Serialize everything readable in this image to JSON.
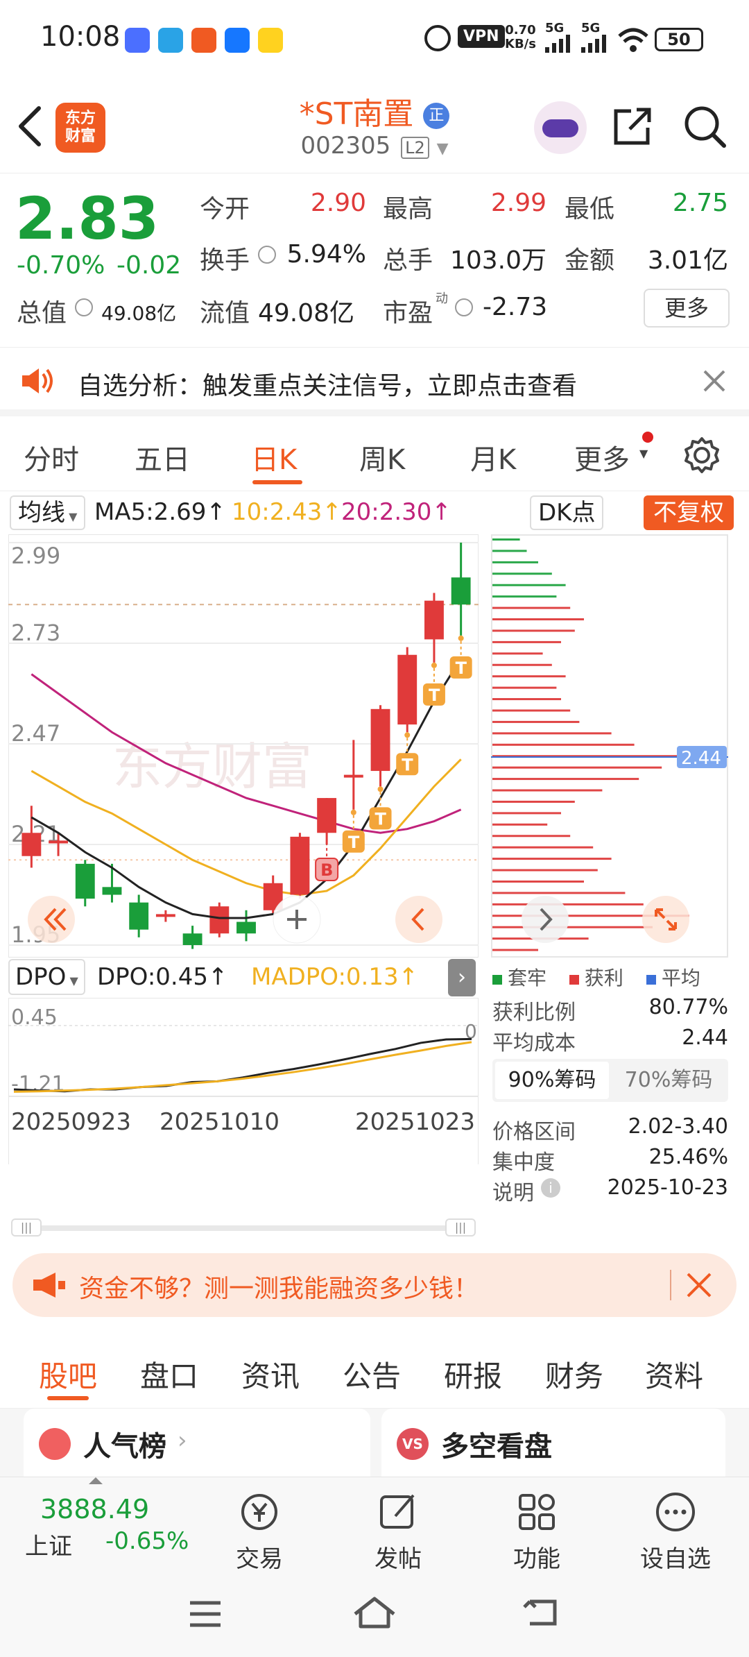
{
  "status_bar": {
    "time": "10:08",
    "network_speed_value": "0.70",
    "network_speed_unit": "KB/s",
    "vpn": "VPN",
    "signal1": "5G",
    "signal2": "5G",
    "battery": "50"
  },
  "header": {
    "logo_line1": "东方",
    "logo_line2": "财富",
    "stock_name": "*ST南置",
    "stock_code": "002305",
    "level_badge": "L2",
    "verified_badge": "正"
  },
  "quote": {
    "price": "2.83",
    "change_pct": "-0.70%",
    "change": "-0.02",
    "fields": {
      "open_label": "今开",
      "open": "2.90",
      "high_label": "最高",
      "high": "2.99",
      "low_label": "最低",
      "low": "2.75",
      "turnover_label": "换手",
      "turnover": "5.94%",
      "volume_label": "总手",
      "volume": "103.0万",
      "amount_label": "金额",
      "amount": "3.01亿",
      "mktcap_label": "总值",
      "mktcap": "49.08亿",
      "float_label": "流值",
      "float": "49.08亿",
      "pe_label": "市盈",
      "pe_super": "动",
      "pe": "-2.73"
    },
    "more_button": "更多"
  },
  "notice": {
    "text": "自选分析：触发重点关注信号，立即点击查看"
  },
  "chart_tabs": [
    "分时",
    "五日",
    "日K",
    "周K",
    "月K",
    "更多"
  ],
  "active_chart_tab": 2,
  "indicators": {
    "ma_dropdown": "均线",
    "ma5": "MA5:2.69",
    "ma10": "10:2.43",
    "ma20": "20:2.30",
    "dk_button": "DK点",
    "fq_button": "不复权",
    "dpo_dropdown": "DPO",
    "dpo": "DPO:0.45",
    "madpo": "MADPO:0.13"
  },
  "colors": {
    "up": "#e03a3a",
    "down": "#1a9e3a",
    "brand": "#f05a22",
    "ma5": "#222222",
    "ma10": "#f0b020",
    "ma20": "#c0227a"
  },
  "chart_data": {
    "type": "candlestick",
    "ylim": [
      1.95,
      2.99
    ],
    "y_ticks": [
      "2.99",
      "2.73",
      "2.47",
      "2.21",
      "1.95"
    ],
    "watermark": "东方财富",
    "candles": [
      {
        "o": 2.18,
        "c": 2.24,
        "h": 2.31,
        "l": 2.15
      },
      {
        "o": 2.22,
        "c": 2.22,
        "h": 2.24,
        "l": 2.18
      },
      {
        "o": 2.16,
        "c": 2.07,
        "h": 2.17,
        "l": 2.05
      },
      {
        "o": 2.1,
        "c": 2.08,
        "h": 2.16,
        "l": 2.06
      },
      {
        "o": 2.06,
        "c": 1.99,
        "h": 2.08,
        "l": 1.97
      },
      {
        "o": 2.03,
        "c": 2.03,
        "h": 2.04,
        "l": 2.01
      },
      {
        "o": 1.98,
        "c": 1.95,
        "h": 2.0,
        "l": 1.94
      },
      {
        "o": 1.98,
        "c": 2.05,
        "h": 2.06,
        "l": 1.97
      },
      {
        "o": 2.01,
        "c": 1.98,
        "h": 2.04,
        "l": 1.96
      },
      {
        "o": 2.04,
        "c": 2.11,
        "h": 2.13,
        "l": 2.03
      },
      {
        "o": 2.08,
        "c": 2.23,
        "h": 2.24,
        "l": 2.07
      },
      {
        "o": 2.24,
        "c": 2.33,
        "h": 2.33,
        "l": 2.21
      },
      {
        "o": 2.39,
        "c": 2.39,
        "h": 2.48,
        "l": 2.3
      },
      {
        "o": 2.4,
        "c": 2.56,
        "h": 2.57,
        "l": 2.36
      },
      {
        "o": 2.52,
        "c": 2.7,
        "h": 2.72,
        "l": 2.5
      },
      {
        "o": 2.74,
        "c": 2.84,
        "h": 2.86,
        "l": 2.68
      },
      {
        "o": 2.9,
        "c": 2.83,
        "h": 2.99,
        "l": 2.75
      }
    ],
    "ma5": [
      2.28,
      2.24,
      2.19,
      2.15,
      2.1,
      2.06,
      2.03,
      2.02,
      2.02,
      2.03,
      2.06,
      2.12,
      2.21,
      2.33,
      2.45,
      2.58,
      2.69
    ],
    "ma10": [
      2.4,
      2.36,
      2.32,
      2.29,
      2.25,
      2.21,
      2.17,
      2.14,
      2.11,
      2.09,
      2.08,
      2.09,
      2.13,
      2.2,
      2.28,
      2.36,
      2.43
    ],
    "ma20": [
      2.65,
      2.6,
      2.55,
      2.5,
      2.46,
      2.42,
      2.39,
      2.36,
      2.33,
      2.31,
      2.29,
      2.27,
      2.25,
      2.24,
      2.25,
      2.27,
      2.3
    ],
    "signals": {
      "B": 11,
      "T": [
        12,
        13,
        14,
        15,
        16
      ]
    },
    "avg_cost_line": 2.44,
    "dpo_ticks": [
      "0.45",
      "-1.21"
    ],
    "dpo_right_tick": "0",
    "dpo": [
      -1.21,
      -1.24,
      -1.26,
      -1.21,
      -1.21,
      -1.15,
      -1.12,
      -1.02,
      -1.0,
      -0.9,
      -0.78,
      -0.68,
      -0.56,
      -0.43,
      -0.29,
      -0.16,
      0.0,
      0.09,
      0.1
    ],
    "madpo": [
      -1.27,
      -1.26,
      -1.24,
      -1.22,
      -1.19,
      -1.15,
      -1.1,
      -1.05,
      -1.0,
      -0.93,
      -0.85,
      -0.76,
      -0.66,
      -0.55,
      -0.43,
      -0.31,
      -0.2,
      -0.08,
      0.02
    ],
    "dates": [
      "20250923",
      "20251010",
      "20251023"
    ]
  },
  "chips": {
    "legend": [
      "套牢",
      "获利",
      "平均"
    ],
    "avg_tag": "2.44",
    "profit_ratio_label": "获利比例",
    "profit_ratio": "80.77%",
    "avg_cost_label": "平均成本",
    "avg_cost": "2.44",
    "tab90": "90%筹码",
    "tab70": "70%筹码",
    "range_label": "价格区间",
    "range": "2.02-3.40",
    "concentration_label": "集中度",
    "concentration": "25.46%",
    "note_label": "说明",
    "note_date": "2025-10-23",
    "bars": [
      {
        "len": 0.12,
        "c": "g"
      },
      {
        "len": 0.15,
        "c": "g"
      },
      {
        "len": 0.2,
        "c": "g"
      },
      {
        "len": 0.26,
        "c": "g"
      },
      {
        "len": 0.32,
        "c": "g"
      },
      {
        "len": 0.28,
        "c": "g"
      },
      {
        "len": 0.34,
        "c": "r"
      },
      {
        "len": 0.4,
        "c": "r"
      },
      {
        "len": 0.36,
        "c": "r"
      },
      {
        "len": 0.3,
        "c": "r"
      },
      {
        "len": 0.22,
        "c": "r"
      },
      {
        "len": 0.26,
        "c": "r"
      },
      {
        "len": 0.32,
        "c": "r"
      },
      {
        "len": 0.28,
        "c": "r"
      },
      {
        "len": 0.3,
        "c": "r"
      },
      {
        "len": 0.34,
        "c": "r"
      },
      {
        "len": 0.38,
        "c": "r"
      },
      {
        "len": 0.52,
        "c": "r"
      },
      {
        "len": 0.62,
        "c": "r"
      },
      {
        "len": 0.92,
        "c": "r"
      },
      {
        "len": 0.74,
        "c": "r"
      },
      {
        "len": 0.64,
        "c": "r"
      },
      {
        "len": 0.48,
        "c": "r"
      },
      {
        "len": 0.36,
        "c": "r"
      },
      {
        "len": 0.3,
        "c": "r"
      },
      {
        "len": 0.24,
        "c": "r"
      },
      {
        "len": 0.34,
        "c": "r"
      },
      {
        "len": 0.44,
        "c": "r"
      },
      {
        "len": 0.52,
        "c": "r"
      },
      {
        "len": 0.46,
        "c": "r"
      },
      {
        "len": 0.4,
        "c": "r"
      },
      {
        "len": 0.58,
        "c": "r"
      },
      {
        "len": 0.66,
        "c": "r"
      },
      {
        "len": 0.86,
        "c": "r"
      },
      {
        "len": 0.7,
        "c": "r"
      },
      {
        "len": 0.42,
        "c": "r"
      },
      {
        "len": 0.2,
        "c": "r"
      }
    ]
  },
  "promo": {
    "text": "资金不够？测一测我能融资多少钱！"
  },
  "sub_tabs": [
    "股吧",
    "盘口",
    "资讯",
    "公告",
    "研报",
    "财务",
    "资料"
  ],
  "active_sub_tab": 0,
  "cards": {
    "hot_rank": "人气榜",
    "vs_badge": "VS",
    "long_short": "多空看盘"
  },
  "bottom_bar": {
    "index_value": "3888.49",
    "index_name": "上证",
    "index_change": "-0.65%",
    "trade": "交易",
    "post": "发帖",
    "functions": "功能",
    "add_watch": "设自选"
  }
}
